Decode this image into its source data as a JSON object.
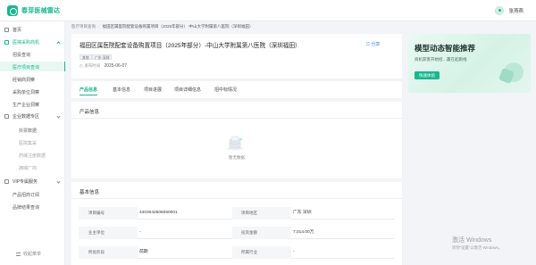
{
  "app": {
    "logo_text": "春芽医械雷达"
  },
  "user": {
    "name": "张燕燕"
  },
  "sidebar": {
    "items": [
      {
        "label": "首页"
      },
      {
        "label": "医械采购商机"
      },
      {
        "label": "招投查询"
      },
      {
        "label": "医疗项目查询"
      },
      {
        "label": "经销商洞察"
      },
      {
        "label": "采购单位洞察"
      },
      {
        "label": "生产企业洞察"
      },
      {
        "label": "企业数据专区"
      },
      {
        "label": "抖票数据"
      },
      {
        "label": "医院集采"
      },
      {
        "label": "药械注册数据"
      },
      {
        "label": "拥械厂商"
      },
      {
        "label": "VIP专属服务"
      },
      {
        "label": "产品招商订阅"
      },
      {
        "label": "品牌结果查询"
      }
    ],
    "collapse_label": "收起菜单"
  },
  "breadcrumb": {
    "items": [
      "医疗项目查询",
      "福田区属医院配套设备购置项目（2025年部分）-中山大学附属第八医院（深圳福田）"
    ]
  },
  "project": {
    "title": "福田区属医院配套设备购置项目（2025年部分）-中山大学附属第八医院（深圳福田）",
    "share_label": "分享",
    "tags": [
      "其他",
      "广东·深圳"
    ],
    "date_label": "发布时间",
    "date_value": "2025-06-07"
  },
  "tabs": [
    "产品信息",
    "基本信息",
    "项目进展",
    "项目详细信息",
    "招中标情况"
  ],
  "product_section": {
    "title": "产品信息",
    "empty_text": "暂无数据"
  },
  "basic_section": {
    "title": "基本信息",
    "rows": [
      {
        "label1": "项目编号",
        "value1": "4403042506060001",
        "label2": "项目地区",
        "value2": "广东 深圳"
      },
      {
        "label1": "业主单位",
        "value1": "-",
        "label2": "投资金额",
        "value2": "7,014.00万"
      },
      {
        "label1": "所处阶段",
        "value1": "前期",
        "label2": "所属行业",
        "value2": "-"
      }
    ]
  },
  "promo": {
    "title": "模型动态智能推荐",
    "subtitle": "商机获客开始招…赢在起跑线",
    "button_label": "快速体验"
  },
  "watermark": {
    "line1": "激活 Windows",
    "line2": "转到\"设置\"以激活 Windows。"
  },
  "colors": {
    "accent": "#19b78e",
    "link": "#2b7de9"
  },
  "icons": [
    "home-icon",
    "chart-icon",
    "building-icon",
    "vip-icon",
    "user-avatar",
    "empty-box-icon",
    "share-icon",
    "calendar-icon"
  ]
}
